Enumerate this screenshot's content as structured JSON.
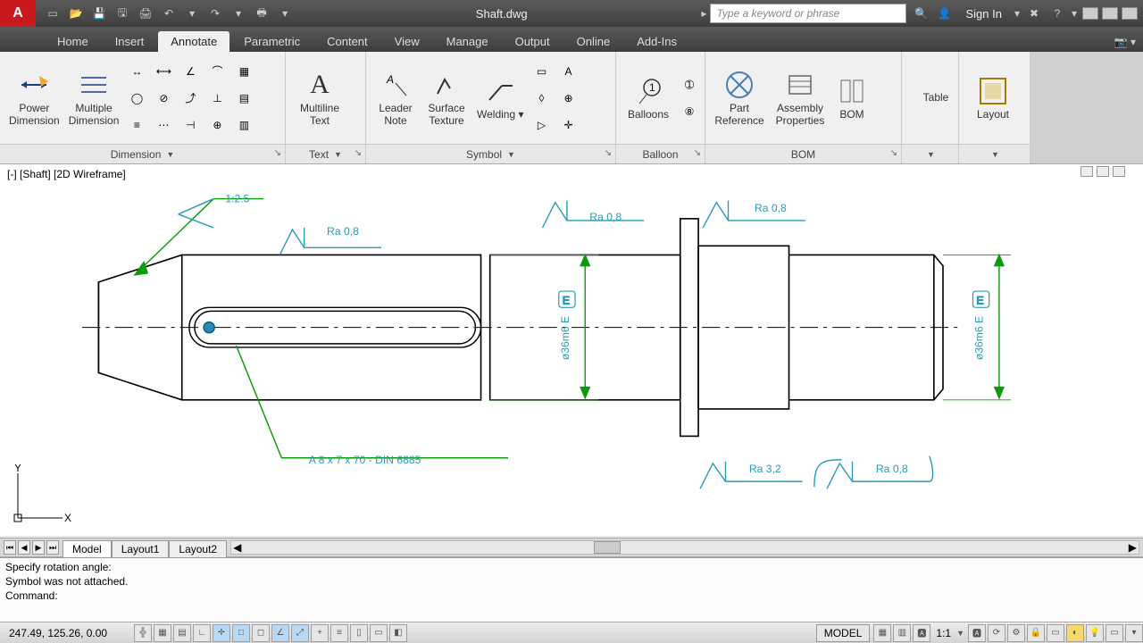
{
  "title": "Shaft.dwg",
  "search_placeholder": "Type a keyword or phrase",
  "signin": "Sign In",
  "tabs": [
    "Home",
    "Insert",
    "Annotate",
    "Parametric",
    "Content",
    "View",
    "Manage",
    "Output",
    "Online",
    "Add-Ins"
  ],
  "active_tab": 2,
  "ribbon": {
    "panels": {
      "dimension": {
        "label": "Dimension",
        "power": "Power\nDimension",
        "multiple": "Multiple\nDimension"
      },
      "text": {
        "label": "Text",
        "multiline": "Multiline\nText"
      },
      "symbol": {
        "label": "Symbol",
        "leader": "Leader\nNote",
        "surface": "Surface\nTexture",
        "welding": "Welding"
      },
      "balloon": {
        "label": "Balloon",
        "balloons": "Balloons"
      },
      "bom": {
        "label": "BOM",
        "part": "Part\nReference",
        "assembly": "Assembly\nProperties",
        "bom": "BOM"
      },
      "table": {
        "label": "Table"
      },
      "layout": {
        "label": "Layout"
      }
    }
  },
  "viewport_label": "[-] [Shaft] [2D Wireframe]",
  "drawing": {
    "annotations": {
      "taper": "1:2.5",
      "ra1": "Ra 0,8",
      "ra2": "Ra 0,8",
      "ra3": "Ra 0,8",
      "ra_bottom1": "Ra 3,2",
      "ra_bottom2": "Ra 0,8",
      "dim1": "ø36m6 E",
      "dim2": "ø36m6 E",
      "key": "A 8 x 7 x 70 - DIN 6885"
    }
  },
  "layout_tabs": [
    "Model",
    "Layout1",
    "Layout2"
  ],
  "active_layout": 0,
  "command_history": [
    "Specify rotation angle:",
    "Symbol was not attached."
  ],
  "command_prompt": "Command:",
  "status": {
    "coords": "247.49, 125.26, 0.00",
    "space": "MODEL",
    "scale": "1:1"
  }
}
